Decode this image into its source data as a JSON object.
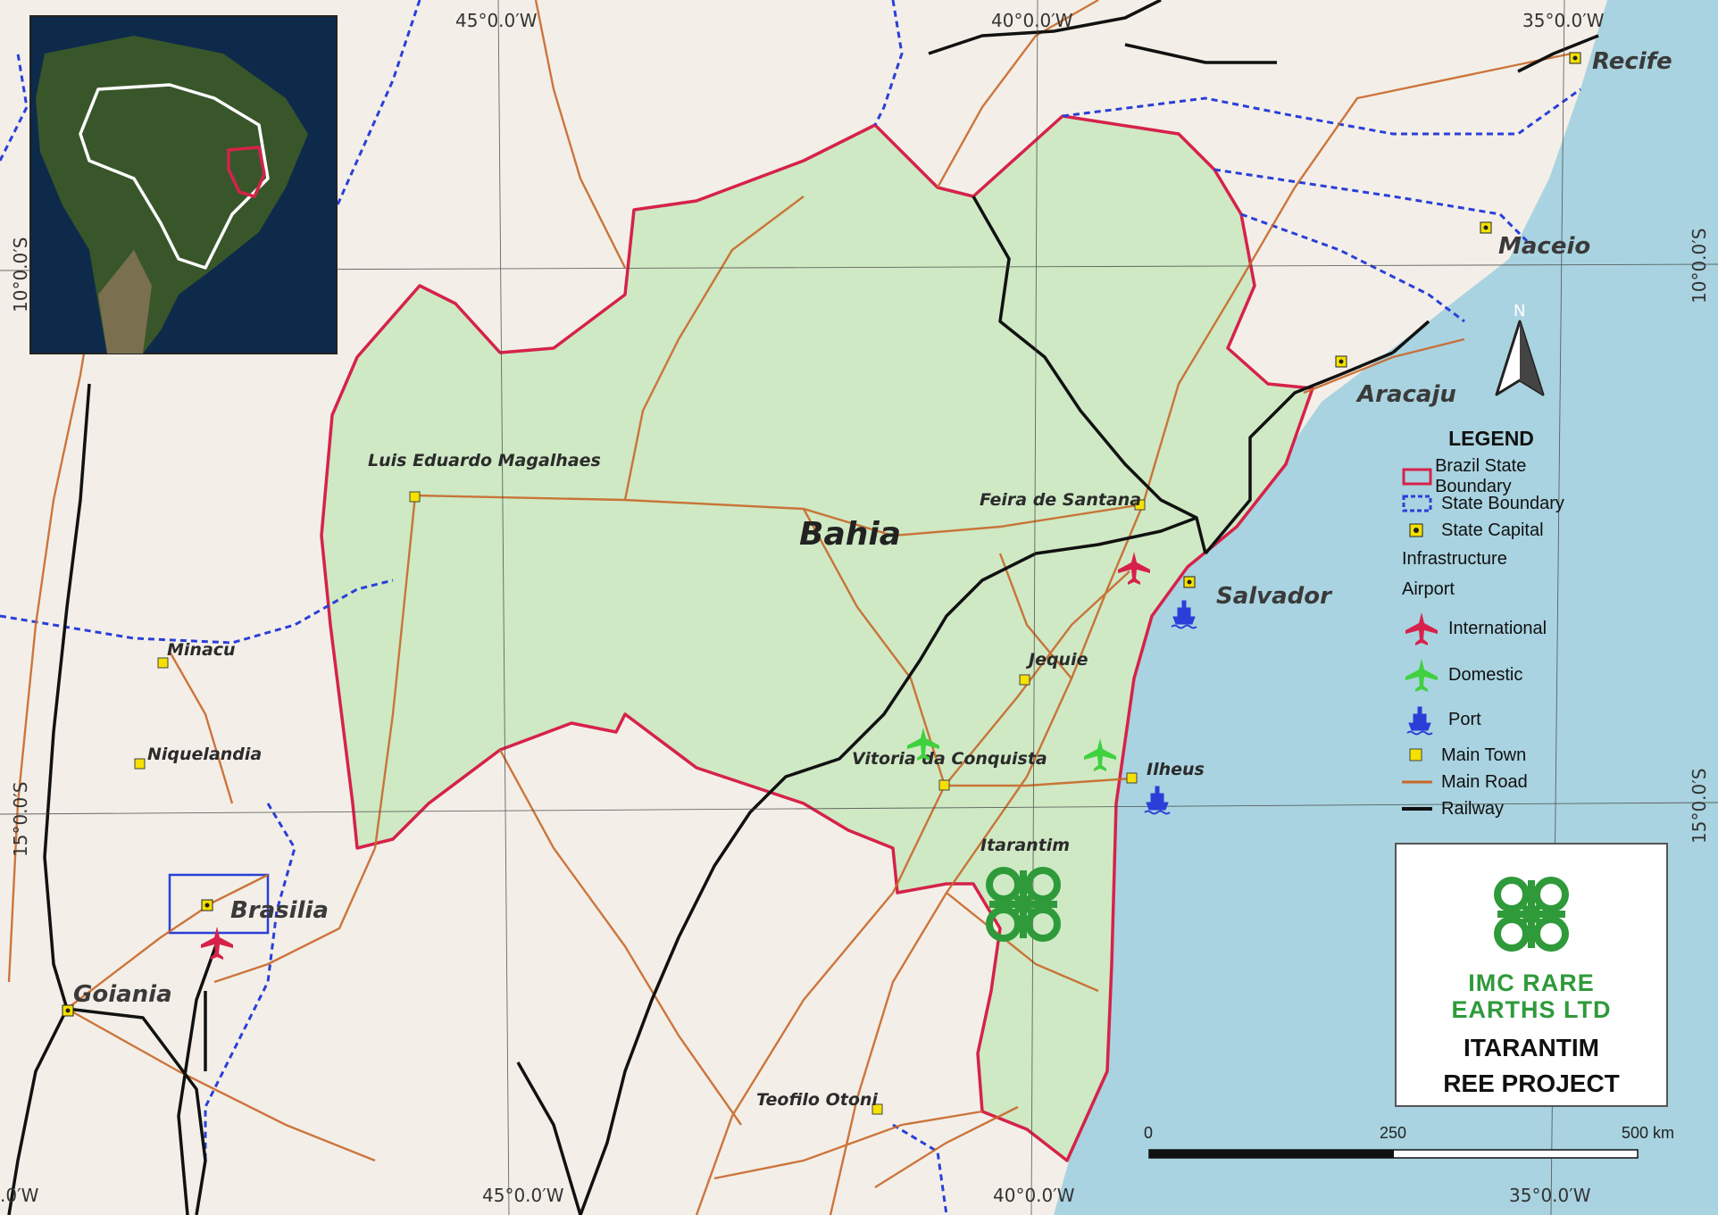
{
  "map": {
    "grid_labels": {
      "top": [
        "45°0.0′W",
        "40°0.0′W",
        "35°0.0′W"
      ],
      "bottom": [
        ".0′W",
        "45°0.0′W",
        "40°0.0′W",
        "35°0.0′W"
      ],
      "left": [
        "10°0.0′S",
        "15°0.0′S"
      ],
      "right": [
        "10°0.0′S",
        "15°0.0′S"
      ]
    },
    "state_label": "Bahia",
    "capitals": [
      "Recife",
      "Maceio",
      "Aracaju",
      "Salvador",
      "Brasilia",
      "Goiania"
    ],
    "towns": [
      "Luis Eduardo Magalhaes",
      "Feira de Santana",
      "Jequie",
      "Vitoria da Conquista",
      "Ilheus",
      "Itarantim",
      "Teofilo Otoni",
      "Minacu",
      "Niquelandia"
    ],
    "north_label": "N",
    "colors": {
      "ocean": "#a9d3e0",
      "land": "#f3efe8",
      "bahia_fill": "#cfe9c4",
      "state_boundary": "#d6224a",
      "other_boundary": "#2a3fd8",
      "road": "#c8682a",
      "railway": "#111111",
      "airport_international": "#d6224a",
      "airport_domestic": "#3fd13f",
      "port": "#2a3fd8",
      "brand_green": "#2f9a3a"
    }
  },
  "legend": {
    "title": "LEGEND",
    "items": [
      {
        "label": "Brazil State Boundary",
        "icon": "red-outline-rect"
      },
      {
        "label": "State Boundary",
        "icon": "blue-dashed-rect"
      },
      {
        "label": "State Capital",
        "icon": "yellow-dot-square"
      },
      {
        "label": "Infrastructure",
        "icon": ""
      },
      {
        "label": "Airport",
        "icon": ""
      },
      {
        "label": "International",
        "icon": "red-plane-icon"
      },
      {
        "label": "Domestic",
        "icon": "green-plane-icon"
      },
      {
        "label": "Port",
        "icon": "ship-icon"
      },
      {
        "label": "Main Town",
        "icon": "yellow-square"
      },
      {
        "label": "Main Road",
        "icon": "orange-line"
      },
      {
        "label": "Railway",
        "icon": "black-line"
      }
    ]
  },
  "logo": {
    "company_line1": "IMC RARE",
    "company_line2": "EARTHS LTD",
    "project_line1": "ITARANTIM",
    "project_line2": "REE PROJECT"
  },
  "scale_bar": {
    "labels": [
      "0",
      "250",
      "500 km"
    ]
  }
}
